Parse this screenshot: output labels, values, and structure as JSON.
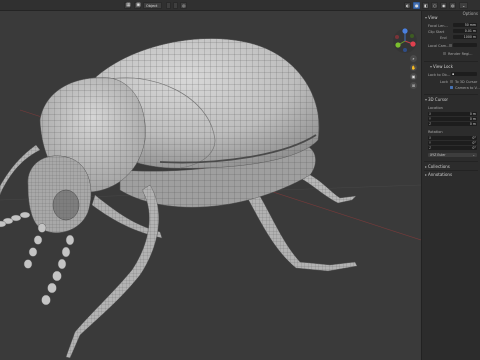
{
  "header": {
    "mode_label": "Object",
    "tab_label": "Options"
  },
  "viewport": {
    "gizmo": {
      "x": "X",
      "y": "Y",
      "z": "Z"
    },
    "subject": "beetle wireframe sculpt"
  },
  "sidebar": {
    "tabs": [
      "Item",
      "Tool",
      "View"
    ],
    "view_panel": {
      "title": "View",
      "focal_length": {
        "label": "Focal Len...",
        "value": "50 mm"
      },
      "clip_start": {
        "label": "Clip Start",
        "value": "0.01 m"
      },
      "clip_end": {
        "label": "End",
        "value": "1000 m"
      },
      "local_camera": {
        "label": "Local Cam...",
        "value": ""
      },
      "render_region": {
        "label": "Render Regi...",
        "checked": false
      }
    },
    "view_lock": {
      "title": "View Lock",
      "lock_to_object": {
        "label": "Lock to Ob...",
        "value": ""
      },
      "lock": {
        "label": "Lock",
        "option1": "To 3D Cursor",
        "option2": "Camera to V..."
      }
    },
    "cursor_panel": {
      "title": "3D Cursor",
      "location": {
        "label": "Location",
        "rows": [
          {
            "axis": "X",
            "value": "0 m"
          },
          {
            "axis": "Y",
            "value": "0 m"
          },
          {
            "axis": "Z",
            "value": "0 m"
          }
        ]
      },
      "rotation": {
        "label": "Rotation",
        "rows": [
          {
            "axis": "X",
            "value": "0°"
          },
          {
            "axis": "Y",
            "value": "0°"
          },
          {
            "axis": "Z",
            "value": "0°"
          }
        ]
      },
      "mode": "XYZ Euler"
    },
    "collections": {
      "title": "Collections"
    },
    "annotations": {
      "title": "Annotations"
    }
  }
}
